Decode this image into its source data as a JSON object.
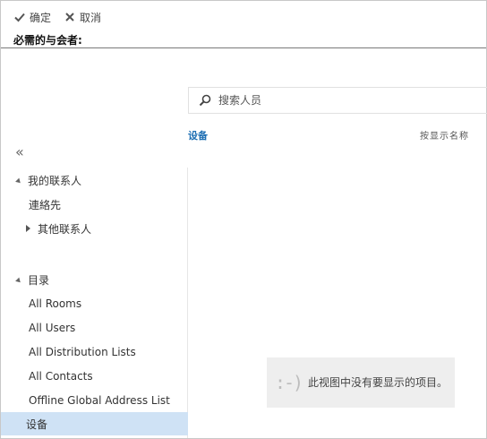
{
  "toolbar": {
    "ok_label": "确定",
    "cancel_label": "取消"
  },
  "attendees": {
    "required_label": "必需的与会者:"
  },
  "search": {
    "placeholder": "搜索人员"
  },
  "results": {
    "breadcrumb": "设备",
    "sort_label": "按显示名称",
    "empty_face": ":-)",
    "empty_message": "此视图中没有要显示的项目。"
  },
  "sidebar": {
    "collapse_glyph": "«",
    "my_contacts": {
      "label": "我的联系人",
      "items": [
        {
          "label": "連絡先"
        },
        {
          "label": "其他联系人"
        }
      ]
    },
    "directory": {
      "label": "目录",
      "items": [
        {
          "label": "All Rooms"
        },
        {
          "label": "All Users"
        },
        {
          "label": "All Distribution Lists"
        },
        {
          "label": "All Contacts"
        },
        {
          "label": "Offline Global Address List"
        },
        {
          "label": "设备"
        }
      ],
      "selected_index": 5
    }
  },
  "colors": {
    "accent": "#1e6fb3",
    "selected_bg": "#cfe2f5",
    "empty_bg": "#eeeeee"
  }
}
